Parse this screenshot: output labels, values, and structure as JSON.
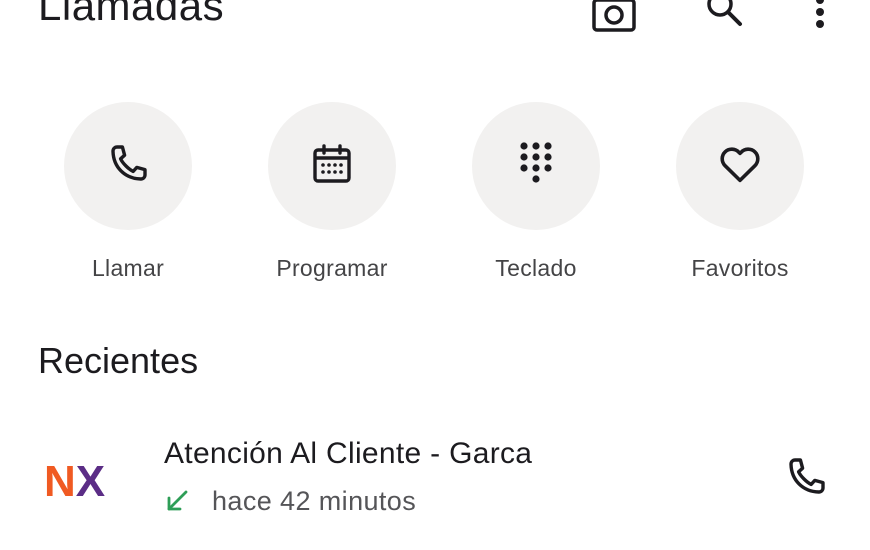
{
  "header": {
    "title": "Llamadas",
    "icons": [
      "camera-icon",
      "search-icon",
      "more-vert-icon"
    ]
  },
  "actions": [
    {
      "label": "Llamar",
      "icon": "phone-icon"
    },
    {
      "label": "Programar",
      "icon": "calendar-icon"
    },
    {
      "label": "Teclado",
      "icon": "dialpad-icon"
    },
    {
      "label": "Favoritos",
      "icon": "heart-icon"
    }
  ],
  "recents": {
    "title": "Recientes",
    "items": [
      {
        "avatar_text": "NX",
        "name": "Atención Al Cliente - Garca",
        "call_type_icon": "incoming-call-arrow-icon",
        "time": "hace 42 minutos"
      }
    ]
  },
  "colors": {
    "circle_bg": "#f2f1f0",
    "incoming_arrow": "#2e9e57",
    "logo_orange": "#f05a22",
    "logo_purple": "#5b2d86"
  }
}
